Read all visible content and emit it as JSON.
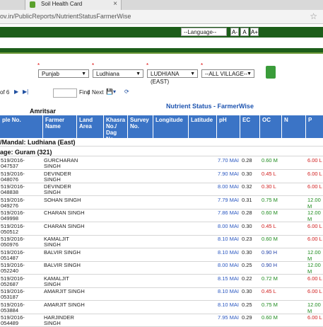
{
  "browser": {
    "tab_title": "Soil Health Card",
    "tab_close": "×",
    "url": "ov.in/PublicReports/NutrientStatusFarmerWise",
    "star_glyph": "☆"
  },
  "site_header": {
    "language_select": "--Language--",
    "font_buttons": [
      "A-",
      "A",
      "A+"
    ]
  },
  "filters": {
    "required_mark": "*",
    "state": "Punjab",
    "district": "Ludhiana",
    "subdistrict": "LUDHIANA (EAST)",
    "village": "--ALL VILLAGE--",
    "caret": "▼"
  },
  "pager": {
    "page_of": "of 6",
    "find": "Find",
    "sep": "|",
    "next": "Next",
    "next_arrow": "▶",
    "last_arrow": "▶|",
    "export_glyph": "💾▾",
    "refresh_glyph": "⟳"
  },
  "report": {
    "title": "Nutrient Status - FarmerWise",
    "district_label": "Amritsar",
    "block_label": "/Mandal: Ludhiana (East)",
    "village_label": "age: Guram (321)"
  },
  "columns": [
    "ple No.",
    "Farmer Name",
    "Land Area",
    "Khasra No./ Dag No.",
    "Survey No.",
    "Longitude",
    "Latitude",
    "pH",
    "EC",
    "OC",
    "N",
    "P"
  ],
  "rows": [
    {
      "sample": [
        "519/2016-",
        "047537"
      ],
      "farmer": [
        "GURCHARAN",
        "SINGH"
      ],
      "ph": "7.70 MAI",
      "ec": "0.28",
      "oc": "0.60 M",
      "oc_class": "green",
      "p": "6.00 L",
      "p_class": "red"
    },
    {
      "sample": [
        "519/2016-",
        "048076"
      ],
      "farmer": [
        "DEVINDER",
        "SINGH"
      ],
      "ph": "7.90 MAI",
      "ec": "0.30",
      "oc": "0.45 L",
      "oc_class": "red",
      "p": "6.00 L",
      "p_class": "red"
    },
    {
      "sample": [
        "519/2016-",
        "048838"
      ],
      "farmer": [
        "DEVINDER",
        "SINGH"
      ],
      "ph": "8.00 MAI",
      "ec": "0.32",
      "oc": "0.30 L",
      "oc_class": "red",
      "p": "6.00 L",
      "p_class": "red"
    },
    {
      "sample": [
        "519/2016-",
        "049276"
      ],
      "farmer": [
        "SOHAN SINGH"
      ],
      "ph": "7.79 MAI",
      "ec": "0.31",
      "oc": "0.75 M",
      "oc_class": "green",
      "p": "12.00 M",
      "p_class": "green"
    },
    {
      "sample": [
        "519/2016-",
        "049998"
      ],
      "farmer": [
        "CHARAN SINGH"
      ],
      "ph": "7.86 MAI",
      "ec": "0.28",
      "oc": "0.60 M",
      "oc_class": "green",
      "p": "12.00 M",
      "p_class": "green"
    },
    {
      "sample": [
        "519/2016-",
        "050512"
      ],
      "farmer": [
        "CHARAN SINGH"
      ],
      "ph": "8.00 MAI",
      "ec": "0.30",
      "oc": "0.45 L",
      "oc_class": "red",
      "p": "6.00 L",
      "p_class": "red"
    },
    {
      "sample": [
        "519/2016-",
        "050976"
      ],
      "farmer": [
        "KAMALJIT",
        "SINGH"
      ],
      "ph": "8.10 MAI",
      "ec": "0.23",
      "oc": "0.60 M",
      "oc_class": "green",
      "p": "6.00 L",
      "p_class": "red"
    },
    {
      "sample": [
        "519/2016-",
        "051487"
      ],
      "farmer": [
        "BALVIR SINGH"
      ],
      "ph": "8.10 MAI",
      "ec": "0.30",
      "oc": "0.90 H",
      "oc_class": "blue",
      "p": "12.00 M",
      "p_class": "green"
    },
    {
      "sample": [
        "519/2016-",
        "052240"
      ],
      "farmer": [
        "BALVIR SINGH"
      ],
      "ph": "8.00 MAI",
      "ec": "0.25",
      "oc": "0.90 H",
      "oc_class": "blue",
      "p": "12.00 M",
      "p_class": "green"
    },
    {
      "sample": [
        "519/2016-",
        "052687"
      ],
      "farmer": [
        "KAMALJIT",
        "SINGH"
      ],
      "ph": "8.15 MAI",
      "ec": "0.22",
      "oc": "0.72 M",
      "oc_class": "green",
      "p": "6.00 L",
      "p_class": "red"
    },
    {
      "sample": [
        "519/2016-",
        "053187"
      ],
      "farmer": [
        "AMARJIT SINGH"
      ],
      "ph": "8.10 MAI",
      "ec": "0.30",
      "oc": "0.45 L",
      "oc_class": "red",
      "p": "6.00 L",
      "p_class": "red"
    },
    {
      "sample": [
        "519/2016-",
        "053884"
      ],
      "farmer": [
        "AMARJIT SINGH"
      ],
      "ph": "8.10 MAI",
      "ec": "0.25",
      "oc": "0.75 M",
      "oc_class": "green",
      "p": "12.00 M",
      "p_class": "green"
    },
    {
      "sample": [
        "519/2016-",
        "054489"
      ],
      "farmer": [
        "HARJINDER",
        "SINGH"
      ],
      "ph": "7.95 MAI",
      "ec": "0.29",
      "oc": "0.60 M",
      "oc_class": "green",
      "p": "6.00 L",
      "p_class": "red"
    }
  ],
  "colors": {
    "header_blue": "#3b74c6",
    "site_green": "#1d5e1a",
    "title_blue": "#1f55b0"
  }
}
